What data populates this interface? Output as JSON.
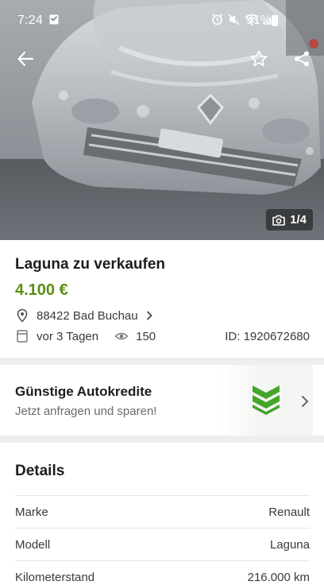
{
  "status_bar": {
    "time": "7:24",
    "battery": "91%"
  },
  "gallery": {
    "photo_counter": "1/4"
  },
  "listing": {
    "title": "Laguna zu verkaufen",
    "price": "4.100 €",
    "location": "88422 Bad Buchau",
    "posted": "vor 3 Tagen",
    "views": "150",
    "id_label": "ID: 1920672680"
  },
  "promo": {
    "title": "Günstige Autokredite",
    "subtitle": "Jetzt anfragen und sparen!"
  },
  "details": {
    "heading": "Details",
    "rows": [
      {
        "label": "Marke",
        "value": "Renault"
      },
      {
        "label": "Modell",
        "value": "Laguna"
      },
      {
        "label": "Kilometerstand",
        "value": "216.000 km"
      }
    ]
  },
  "colors": {
    "price": "#5b8f12",
    "logo_green": "#43a52a",
    "separator": "#eeeeee"
  },
  "icons": {
    "back": "arrow-left-icon",
    "favorite": "star-outline-icon",
    "share": "share-icon",
    "camera": "camera-icon",
    "location": "location-pin-icon",
    "calendar": "calendar-icon",
    "views": "eye-icon",
    "chevron": "chevron-right-icon"
  }
}
